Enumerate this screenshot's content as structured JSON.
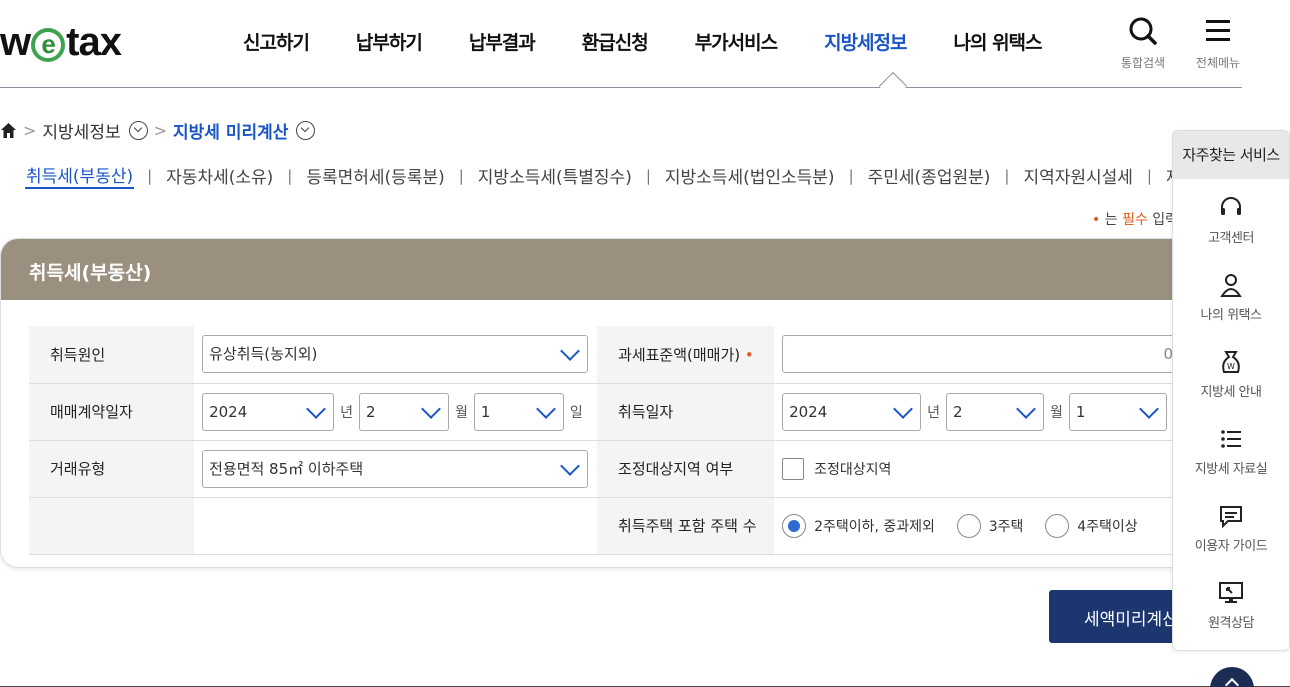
{
  "header": {
    "logo": {
      "w": "w",
      "e": "e",
      "rest": "tax"
    },
    "nav": [
      "신고하기",
      "납부하기",
      "납부결과",
      "환급신청",
      "부가서비스",
      "지방세정보",
      "나의 위택스"
    ],
    "active_nav_index": 5,
    "search_label": "통합검색",
    "menu_label": "전체메뉴"
  },
  "breadcrumb": {
    "level1": "지방세정보",
    "level2": "지방세 미리계산"
  },
  "tabs": [
    "취득세(부동산)",
    "자동차세(소유)",
    "등록면허세(등록분)",
    "지방소득세(특별징수)",
    "지방소득세(법인소득분)",
    "주민세(종업원분)",
    "지역자원시설세",
    "재산세(세율"
  ],
  "required_note": {
    "prefix": "는 ",
    "highlight": "필수",
    "suffix": " 입력항"
  },
  "panel": {
    "title": "취득세(부동산)",
    "rows": {
      "cause_label": "취득원인",
      "cause_value": "유상취득(농지외)",
      "tax_base_label": "과세표준액(매매가)",
      "tax_base_value": "0",
      "contract_date_label": "매매계약일자",
      "contract_year": "2024",
      "contract_month": "2",
      "contract_day": "1",
      "acquisition_date_label": "취득일자",
      "acq_year": "2024",
      "acq_month": "2",
      "acq_day": "1",
      "unit_year": "년",
      "unit_month": "월",
      "unit_day": "일",
      "trade_type_label": "거래유형",
      "trade_type_value": "전용면적 85㎡ 이하주택",
      "adjust_area_label": "조정대상지역 여부",
      "adjust_area_checkbox": "조정대상지역",
      "house_count_label": "취득주택 포함 주택 수",
      "house_count_options": [
        "2주택이하, 중과제외",
        "3주택",
        "4주택이상"
      ],
      "house_count_selected": 0
    }
  },
  "calc_button": "세액미리계산",
  "quick_menu": {
    "title": "자주찾는 서비스",
    "items": [
      "고객센터",
      "나의 위택스",
      "지방세 안내",
      "지방세 자료실",
      "이용자 가이드",
      "원격상담"
    ]
  },
  "colors": {
    "accent": "#1a55c6",
    "panel_header": "#9b8f7f",
    "button": "#1c3670",
    "required": "#e05a1a"
  }
}
